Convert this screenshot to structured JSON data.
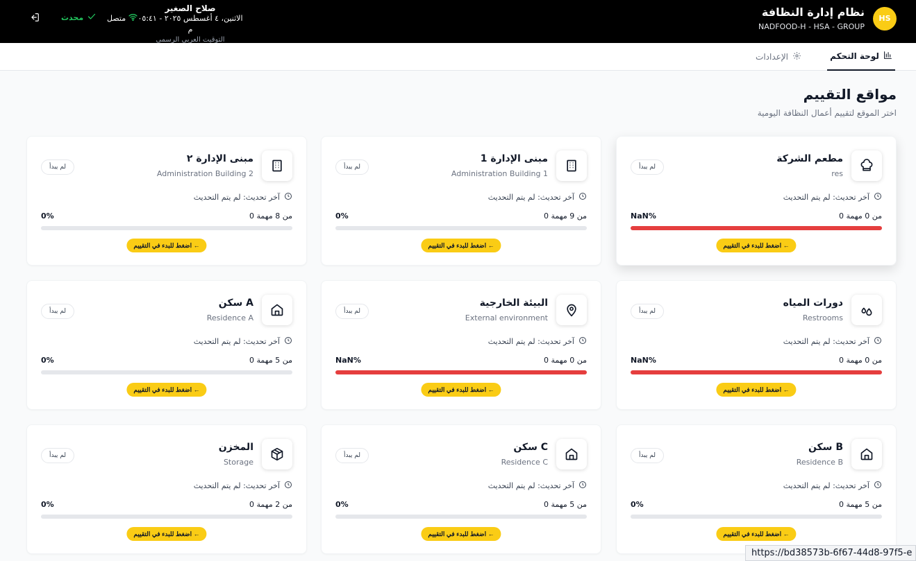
{
  "header": {
    "avatar": "HS",
    "title": "نظام إدارة النظافة",
    "subtitle": "NADFOOD-H - HSA - GROUP",
    "user_name": "صلاح الصغير",
    "datetime": "الاثنين، ٤ أغسطس ٢٠٢٥ - ٠٥:٤١ م",
    "timezone": "التوقيت العربي الرسمي",
    "connection": "متصل",
    "updated": "محدث"
  },
  "tabs": {
    "dashboard": "لوحة التحكم",
    "settings": "الإعدادات"
  },
  "page": {
    "title": "مواقع التقييم",
    "subtitle": "اختر الموقع لتقييم أعمال النظافة اليومية"
  },
  "cards": [
    {
      "name": "مطعم الشركة",
      "en": "res",
      "badge": "لم يبدأ",
      "updated": "آخر تحديث: لم يتم التحديث",
      "count": "0 من 0 مهمة",
      "pct": "NaN%",
      "fill": 1.0,
      "icon": "chef-hat-icon",
      "button": "اضغط للبدء في التقييم ←"
    },
    {
      "name": "مبنى الإدارة 1",
      "en": "Administration Building 1",
      "badge": "لم يبدأ",
      "updated": "آخر تحديث: لم يتم التحديث",
      "count": "0 من 9 مهمة",
      "pct": "0%",
      "fill": 0,
      "icon": "building-icon",
      "button": "اضغط للبدء في التقييم ←"
    },
    {
      "name": "مبنى الإدارة ٢",
      "en": "Administration Building 2",
      "badge": "لم يبدأ",
      "updated": "آخر تحديث: لم يتم التحديث",
      "count": "0 من 8 مهمة",
      "pct": "0%",
      "fill": 0,
      "icon": "building-icon",
      "button": "اضغط للبدء في التقييم ←"
    },
    {
      "name": "دورات المياه",
      "en": "Restrooms",
      "badge": "لم يبدأ",
      "updated": "آخر تحديث: لم يتم التحديث",
      "count": "0 من 0 مهمة",
      "pct": "NaN%",
      "fill": 1.0,
      "icon": "droplets-icon",
      "button": "اضغط للبدء في التقييم ←"
    },
    {
      "name": "البيئة الخارجية",
      "en": "External environment",
      "badge": "لم يبدأ",
      "updated": "آخر تحديث: لم يتم التحديث",
      "count": "0 من 0 مهمة",
      "pct": "NaN%",
      "fill": 1.0,
      "icon": "map-pin-icon",
      "button": "اضغط للبدء في التقييم ←"
    },
    {
      "name": "سكن A",
      "en": "Residence A",
      "badge": "لم يبدأ",
      "updated": "آخر تحديث: لم يتم التحديث",
      "count": "0 من 5 مهمة",
      "pct": "0%",
      "fill": 0,
      "icon": "home-icon",
      "button": "اضغط للبدء في التقييم ←"
    },
    {
      "name": "سكن B",
      "en": "Residence B",
      "badge": "لم يبدأ",
      "updated": "آخر تحديث: لم يتم التحديث",
      "count": "0 من 5 مهمة",
      "pct": "0%",
      "fill": 0,
      "icon": "home-icon",
      "button": "اضغط للبدء في التقييم ←"
    },
    {
      "name": "سكن C",
      "en": "Residence C",
      "badge": "لم يبدأ",
      "updated": "آخر تحديث: لم يتم التحديث",
      "count": "0 من 5 مهمة",
      "pct": "0%",
      "fill": 0,
      "icon": "home-icon",
      "button": "اضغط للبدء في التقييم ←"
    },
    {
      "name": "المخزن",
      "en": "Storage",
      "badge": "لم يبدأ",
      "updated": "آخر تحديث: لم يتم التحديث",
      "count": "0 من 2 مهمة",
      "pct": "0%",
      "fill": 0,
      "icon": "package-icon",
      "button": "اضغط للبدء في التقييم ←"
    }
  ],
  "colors": {
    "accent": "#facc15",
    "progress_fill": "#e53e3e",
    "online": "#22c55e"
  },
  "status_url": "https://bd38573b-6f67-44d8-97f5-e"
}
